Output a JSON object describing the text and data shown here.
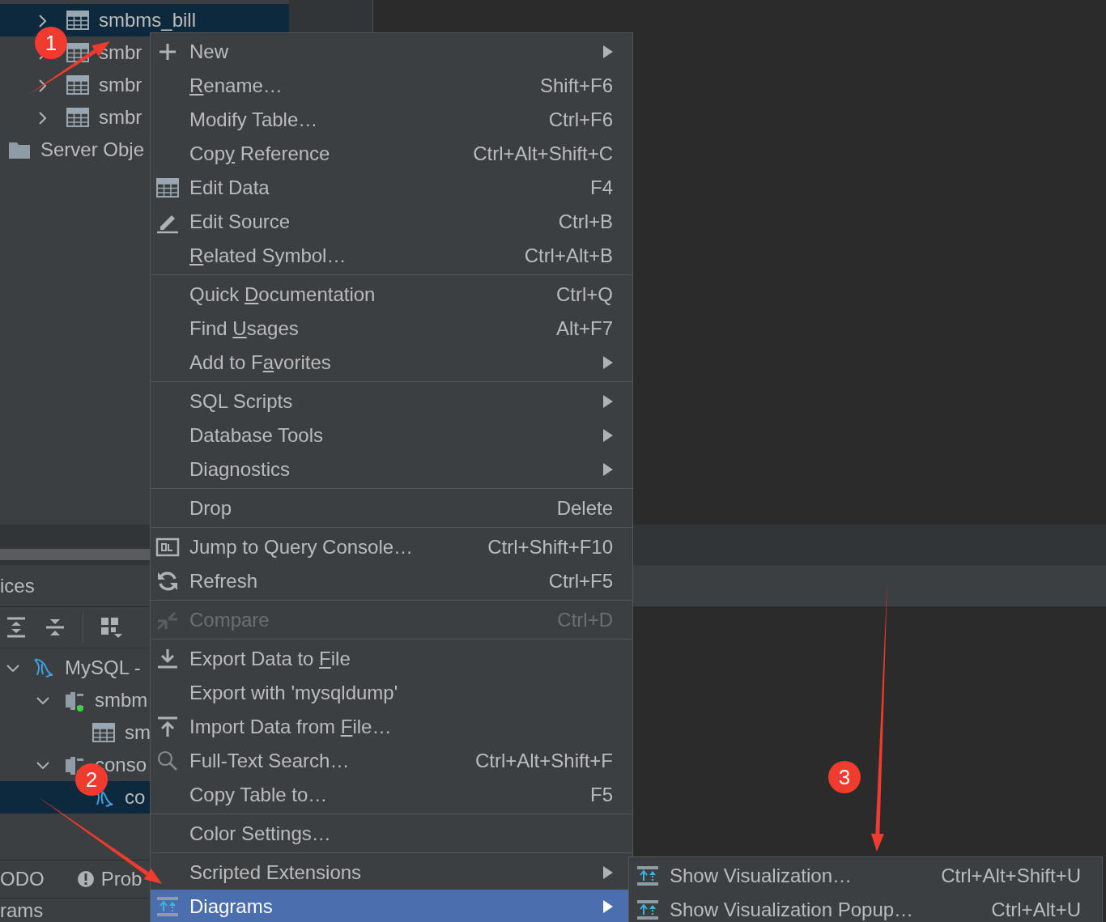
{
  "database_tree": [
    {
      "kind": "table",
      "label": "smbms_bill",
      "expanded": false,
      "selected": true
    },
    {
      "kind": "table",
      "label": "smbr",
      "expanded": false,
      "selected": false
    },
    {
      "kind": "table",
      "label": "smbr",
      "expanded": false,
      "selected": false
    },
    {
      "kind": "table",
      "label": "smbr",
      "expanded": false,
      "selected": false
    },
    {
      "kind": "folder",
      "label": "Server Obje",
      "selected": false
    }
  ],
  "services_panel": {
    "title": "ices",
    "tree": [
      {
        "kind": "mysql",
        "label": "MySQL -",
        "expanded": true,
        "selected": false,
        "children": [
          {
            "kind": "connection",
            "label": "smbm",
            "expanded": true,
            "connected": true,
            "selected": false,
            "children": [
              {
                "kind": "table",
                "label": "sm",
                "selected": false
              }
            ]
          },
          {
            "kind": "connection",
            "label": "conso",
            "expanded": true,
            "connected": false,
            "selected": false,
            "children": [
              {
                "kind": "console",
                "label": "co",
                "selected": true
              }
            ]
          }
        ]
      }
    ],
    "tool_tabs": [
      {
        "kind": "plain",
        "label": "ODO"
      },
      {
        "kind": "problems",
        "label": "Prob"
      }
    ],
    "bottom_label": "rams"
  },
  "context_menu": {
    "groups": [
      [
        {
          "kind": "plus",
          "label": "New",
          "submenu": true,
          "disabled": false,
          "selected": false
        },
        {
          "mnemonic_label": {
            "key": "R",
            "after": "ename…"
          },
          "shortcut": "Shift+F6",
          "submenu": false,
          "disabled": false,
          "selected": false
        },
        {
          "label": "Modify Table…",
          "shortcut": "Ctrl+F6",
          "submenu": false,
          "disabled": false,
          "selected": false
        },
        {
          "mnemonic_label": {
            "before": "Cop",
            "key": "y",
            "after": " Reference"
          },
          "shortcut": "Ctrl+Alt+Shift+C",
          "submenu": false,
          "disabled": false,
          "selected": false
        },
        {
          "kind": "table",
          "label": "Edit Data",
          "shortcut": "F4",
          "submenu": false,
          "disabled": false,
          "selected": false
        },
        {
          "kind": "pencil",
          "label": "Edit Source",
          "shortcut": "Ctrl+B",
          "submenu": false,
          "disabled": false,
          "selected": false
        },
        {
          "mnemonic_label": {
            "key": "R",
            "after": "elated Symbol…"
          },
          "shortcut": "Ctrl+Alt+B",
          "submenu": false,
          "disabled": false,
          "selected": false
        }
      ],
      [
        {
          "mnemonic_label": {
            "before": "Quick ",
            "key": "D",
            "after": "ocumentation"
          },
          "shortcut": "Ctrl+Q",
          "submenu": false,
          "disabled": false,
          "selected": false
        },
        {
          "mnemonic_label": {
            "before": "Find ",
            "key": "U",
            "after": "sages"
          },
          "shortcut": "Alt+F7",
          "submenu": false,
          "disabled": false,
          "selected": false
        },
        {
          "mnemonic_label": {
            "before": "Add to F",
            "key": "a",
            "after": "vorites"
          },
          "submenu": true,
          "disabled": false,
          "selected": false
        }
      ],
      [
        {
          "label": "SQL Scripts",
          "submenu": true,
          "disabled": false,
          "selected": false
        },
        {
          "label": "Database Tools",
          "submenu": true,
          "disabled": false,
          "selected": false
        },
        {
          "label": "Diagnostics",
          "submenu": true,
          "disabled": false,
          "selected": false
        }
      ],
      [
        {
          "label": "Drop",
          "shortcut": "Delete",
          "submenu": false,
          "disabled": false,
          "selected": false
        }
      ],
      [
        {
          "kind": "console",
          "label": "Jump to Query Console…",
          "shortcut": "Ctrl+Shift+F10",
          "submenu": false,
          "disabled": false,
          "selected": false
        },
        {
          "kind": "refresh",
          "label": "Refresh",
          "shortcut": "Ctrl+F5",
          "submenu": false,
          "disabled": false,
          "selected": false
        }
      ],
      [
        {
          "kind": "compare",
          "label": "Compare",
          "shortcut": "Ctrl+D",
          "submenu": false,
          "disabled": true,
          "selected": false
        }
      ],
      [
        {
          "kind": "export",
          "mnemonic_label": {
            "before": "Export Data to ",
            "key": "F",
            "after": "ile"
          },
          "submenu": false,
          "disabled": false,
          "selected": false
        },
        {
          "label": "Export with 'mysqldump'",
          "submenu": false,
          "disabled": false,
          "selected": false
        },
        {
          "kind": "import",
          "mnemonic_label": {
            "before": "Import Data from ",
            "key": "F",
            "after": "ile…"
          },
          "submenu": false,
          "disabled": false,
          "selected": false
        },
        {
          "kind": "search",
          "label": "Full-Text Search…",
          "shortcut": "Ctrl+Alt+Shift+F",
          "submenu": false,
          "disabled": false,
          "selected": false
        },
        {
          "label": "Copy Table to…",
          "shortcut": "F5",
          "submenu": false,
          "disabled": false,
          "selected": false
        }
      ],
      [
        {
          "label": "Color Settings…",
          "submenu": false,
          "disabled": false,
          "selected": false
        }
      ],
      [
        {
          "label": "Scripted Extensions",
          "submenu": true,
          "disabled": false,
          "selected": false
        },
        {
          "kind": "diagram",
          "label": "Diagrams",
          "submenu": true,
          "disabled": false,
          "selected": true
        }
      ]
    ]
  },
  "diagrams_submenu": [
    {
      "kind": "diagram",
      "label": "Show Visualization…",
      "shortcut": "Ctrl+Alt+Shift+U"
    },
    {
      "kind": "diagram",
      "label": "Show Visualization Popup…",
      "shortcut": "Ctrl+Alt+U"
    }
  ],
  "annotations": [
    {
      "label": "1"
    },
    {
      "label": "2"
    },
    {
      "label": "3"
    }
  ]
}
